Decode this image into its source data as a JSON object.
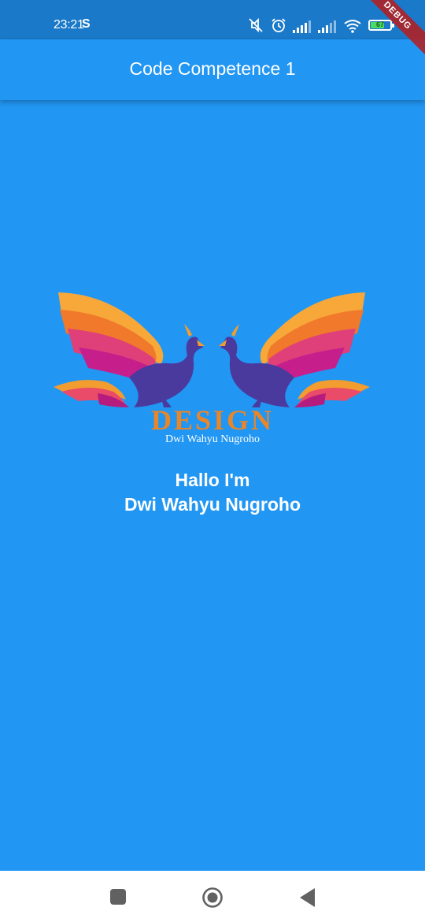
{
  "status_bar": {
    "time": "23:21",
    "s_icon": "S",
    "battery_level": "67",
    "icons": [
      "mute-icon",
      "alarm-icon",
      "signal-icon",
      "signal-icon",
      "wifi-icon",
      "battery-icon"
    ]
  },
  "debug_banner": "DEBUG",
  "app_bar": {
    "title": "Code Competence 1"
  },
  "logo": {
    "word": "DESIGN",
    "subtitle": "Dwi Wahyu Nugroho"
  },
  "greeting": {
    "line1": "Hallo I'm",
    "line2": "Dwi Wahyu Nugroho"
  },
  "nav": {
    "items": [
      "recents-button",
      "home-button",
      "back-button"
    ]
  },
  "colors": {
    "primary": "#2196F3",
    "status_bar": "#1a79c8",
    "logo_text": "#e8862a",
    "wing_orange": "#f39c2f",
    "wing_magenta": "#d81b8a",
    "body_purple": "#4b3a9e"
  }
}
